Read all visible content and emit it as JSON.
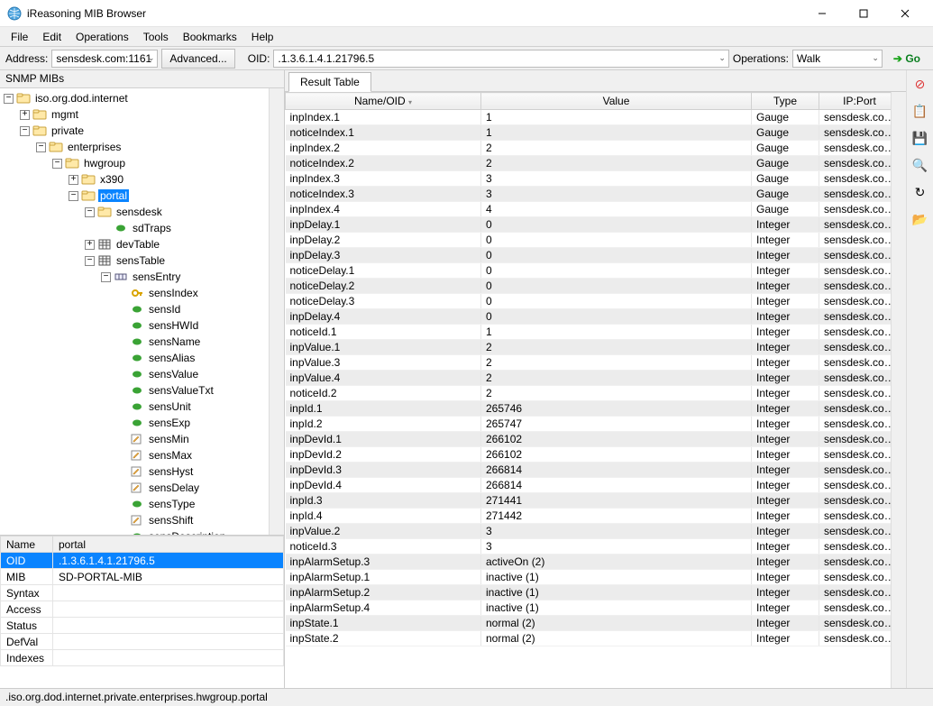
{
  "window": {
    "title": "iReasoning MIB Browser"
  },
  "menu": [
    "File",
    "Edit",
    "Operations",
    "Tools",
    "Bookmarks",
    "Help"
  ],
  "toolbar": {
    "address_label": "Address:",
    "address_value": "sensdesk.com:1161",
    "advanced_label": "Advanced...",
    "oid_label": "OID:",
    "oid_value": ".1.3.6.1.4.1.21796.5",
    "operations_label": "Operations:",
    "operations_value": "Walk",
    "go_label": "Go"
  },
  "snmp_label": "SNMP MIBs",
  "tree": [
    {
      "d": 0,
      "t": "-",
      "i": "folder",
      "l": "iso.org.dod.internet"
    },
    {
      "d": 1,
      "t": "+",
      "i": "folder",
      "l": "mgmt"
    },
    {
      "d": 1,
      "t": "-",
      "i": "folder",
      "l": "private"
    },
    {
      "d": 2,
      "t": "-",
      "i": "folder",
      "l": "enterprises"
    },
    {
      "d": 3,
      "t": "-",
      "i": "folder",
      "l": "hwgroup"
    },
    {
      "d": 4,
      "t": "+",
      "i": "folder",
      "l": "x390"
    },
    {
      "d": 4,
      "t": "-",
      "i": "folder",
      "l": "portal",
      "sel": true
    },
    {
      "d": 5,
      "t": "-",
      "i": "folder",
      "l": "sensdesk"
    },
    {
      "d": 6,
      "t": "",
      "i": "leaf",
      "l": "sdTraps"
    },
    {
      "d": 5,
      "t": "+",
      "i": "table",
      "l": "devTable"
    },
    {
      "d": 5,
      "t": "-",
      "i": "table",
      "l": "sensTable"
    },
    {
      "d": 6,
      "t": "-",
      "i": "entry",
      "l": "sensEntry"
    },
    {
      "d": 7,
      "t": "",
      "i": "key",
      "l": "sensIndex"
    },
    {
      "d": 7,
      "t": "",
      "i": "leaf",
      "l": "sensId"
    },
    {
      "d": 7,
      "t": "",
      "i": "leaf",
      "l": "sensHWId"
    },
    {
      "d": 7,
      "t": "",
      "i": "leaf",
      "l": "sensName"
    },
    {
      "d": 7,
      "t": "",
      "i": "leaf",
      "l": "sensAlias"
    },
    {
      "d": 7,
      "t": "",
      "i": "leaf",
      "l": "sensValue"
    },
    {
      "d": 7,
      "t": "",
      "i": "leaf",
      "l": "sensValueTxt"
    },
    {
      "d": 7,
      "t": "",
      "i": "leaf",
      "l": "sensUnit"
    },
    {
      "d": 7,
      "t": "",
      "i": "leaf",
      "l": "sensExp"
    },
    {
      "d": 7,
      "t": "",
      "i": "pencil",
      "l": "sensMin"
    },
    {
      "d": 7,
      "t": "",
      "i": "pencil",
      "l": "sensMax"
    },
    {
      "d": 7,
      "t": "",
      "i": "pencil",
      "l": "sensHyst"
    },
    {
      "d": 7,
      "t": "",
      "i": "pencil",
      "l": "sensDelay"
    },
    {
      "d": 7,
      "t": "",
      "i": "leaf",
      "l": "sensType"
    },
    {
      "d": 7,
      "t": "",
      "i": "pencil",
      "l": "sensShift"
    },
    {
      "d": 7,
      "t": "",
      "i": "leaf",
      "l": "sensDescription"
    }
  ],
  "details": {
    "headers": [
      "Name",
      "portal"
    ],
    "rows": [
      {
        "k": "OID",
        "v": ".1.3.6.1.4.1.21796.5",
        "sel": true
      },
      {
        "k": "MIB",
        "v": "SD-PORTAL-MIB"
      },
      {
        "k": "Syntax",
        "v": ""
      },
      {
        "k": "Access",
        "v": ""
      },
      {
        "k": "Status",
        "v": ""
      },
      {
        "k": "DefVal",
        "v": ""
      },
      {
        "k": "Indexes",
        "v": ""
      }
    ]
  },
  "result": {
    "tab": "Result Table",
    "columns": [
      "Name/OID",
      "Value",
      "Type",
      "IP:Port"
    ],
    "rows": [
      [
        "inpIndex.1",
        "1",
        "Gauge",
        "sensdesk.com:..."
      ],
      [
        "noticeIndex.1",
        "1",
        "Gauge",
        "sensdesk.com:..."
      ],
      [
        "inpIndex.2",
        "2",
        "Gauge",
        "sensdesk.com:..."
      ],
      [
        "noticeIndex.2",
        "2",
        "Gauge",
        "sensdesk.com:..."
      ],
      [
        "inpIndex.3",
        "3",
        "Gauge",
        "sensdesk.com:..."
      ],
      [
        "noticeIndex.3",
        "3",
        "Gauge",
        "sensdesk.com:..."
      ],
      [
        "inpIndex.4",
        "4",
        "Gauge",
        "sensdesk.com:..."
      ],
      [
        "inpDelay.1",
        "0",
        "Integer",
        "sensdesk.com:..."
      ],
      [
        "inpDelay.2",
        "0",
        "Integer",
        "sensdesk.com:..."
      ],
      [
        "inpDelay.3",
        "0",
        "Integer",
        "sensdesk.com:..."
      ],
      [
        "noticeDelay.1",
        "0",
        "Integer",
        "sensdesk.com:..."
      ],
      [
        "noticeDelay.2",
        "0",
        "Integer",
        "sensdesk.com:..."
      ],
      [
        "noticeDelay.3",
        "0",
        "Integer",
        "sensdesk.com:..."
      ],
      [
        "inpDelay.4",
        "0",
        "Integer",
        "sensdesk.com:..."
      ],
      [
        "noticeId.1",
        "1",
        "Integer",
        "sensdesk.com:..."
      ],
      [
        "inpValue.1",
        "2",
        "Integer",
        "sensdesk.com:..."
      ],
      [
        "inpValue.3",
        "2",
        "Integer",
        "sensdesk.com:..."
      ],
      [
        "inpValue.4",
        "2",
        "Integer",
        "sensdesk.com:..."
      ],
      [
        "noticeId.2",
        "2",
        "Integer",
        "sensdesk.com:..."
      ],
      [
        "inpId.1",
        "265746",
        "Integer",
        "sensdesk.com:..."
      ],
      [
        "inpId.2",
        "265747",
        "Integer",
        "sensdesk.com:..."
      ],
      [
        "inpDevId.1",
        "266102",
        "Integer",
        "sensdesk.com:..."
      ],
      [
        "inpDevId.2",
        "266102",
        "Integer",
        "sensdesk.com:..."
      ],
      [
        "inpDevId.3",
        "266814",
        "Integer",
        "sensdesk.com:..."
      ],
      [
        "inpDevId.4",
        "266814",
        "Integer",
        "sensdesk.com:..."
      ],
      [
        "inpId.3",
        "271441",
        "Integer",
        "sensdesk.com:..."
      ],
      [
        "inpId.4",
        "271442",
        "Integer",
        "sensdesk.com:..."
      ],
      [
        "inpValue.2",
        "3",
        "Integer",
        "sensdesk.com:..."
      ],
      [
        "noticeId.3",
        "3",
        "Integer",
        "sensdesk.com:..."
      ],
      [
        "inpAlarmSetup.3",
        "activeOn (2)",
        "Integer",
        "sensdesk.com:..."
      ],
      [
        "inpAlarmSetup.1",
        "inactive (1)",
        "Integer",
        "sensdesk.com:..."
      ],
      [
        "inpAlarmSetup.2",
        "inactive (1)",
        "Integer",
        "sensdesk.com:..."
      ],
      [
        "inpAlarmSetup.4",
        "inactive (1)",
        "Integer",
        "sensdesk.com:..."
      ],
      [
        "inpState.1",
        "normal (2)",
        "Integer",
        "sensdesk.com:..."
      ],
      [
        "inpState.2",
        "normal (2)",
        "Integer",
        "sensdesk.com:..."
      ]
    ]
  },
  "status": ".iso.org.dod.internet.private.enterprises.hwgroup.portal"
}
